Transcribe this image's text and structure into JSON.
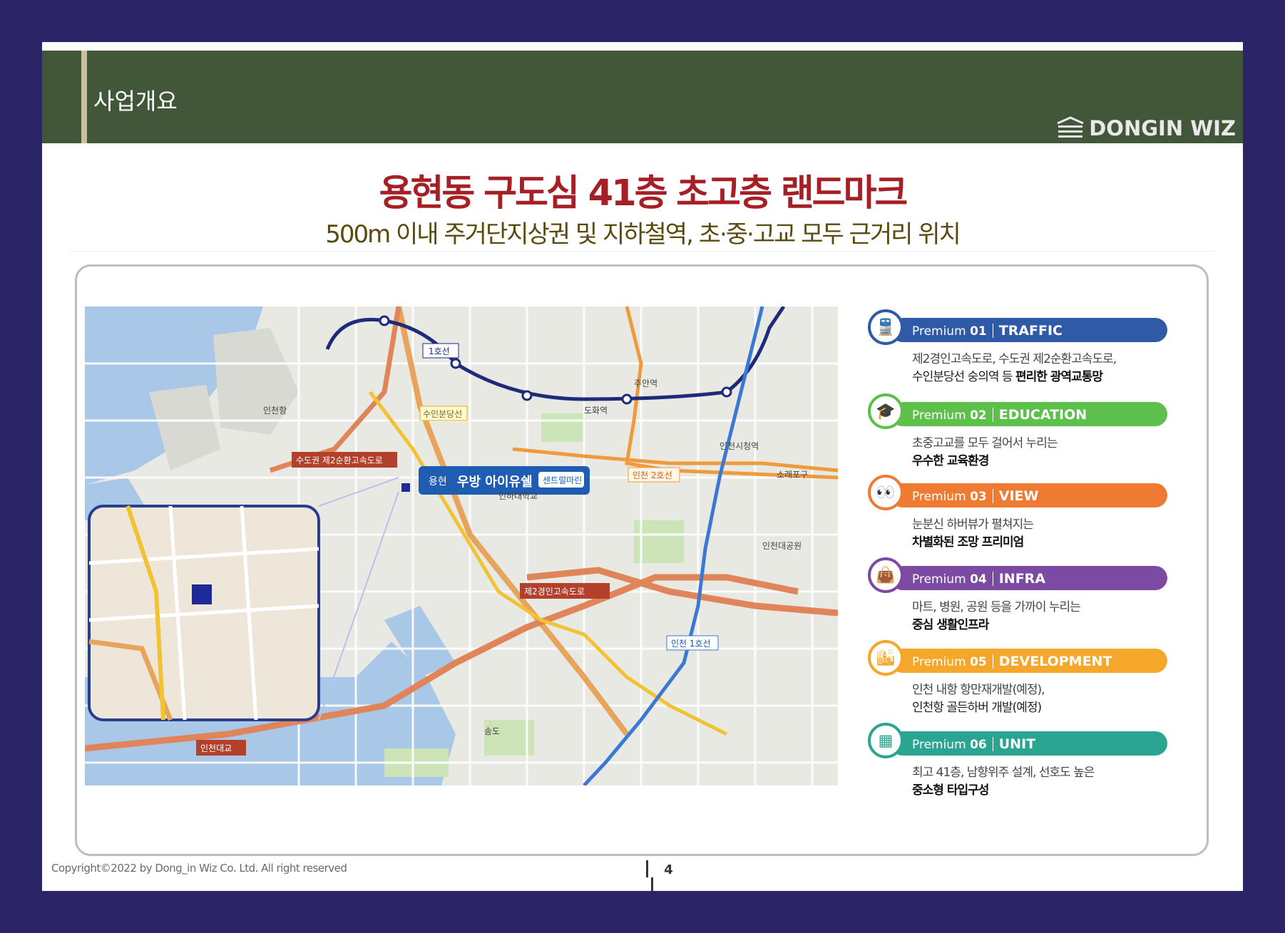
{
  "header": {
    "section_title": "사업개요",
    "logo_text": "DONGIN WIZ"
  },
  "headline": "용현동 구도심 41층 초고층 랜드마크",
  "subheadline": "500m 이내 주거단지상권 및 지하철역, 초·중·고교 모두 근거리 위치",
  "map": {
    "project_label_prefix": "용현",
    "project_label_main": "우방 아이유쉘",
    "project_label_tag": "센트럴마린",
    "road_labels": [
      "수도권 제2순환고속도로",
      "제2경인고속도로",
      "인천대교",
      "인천 2호선",
      "인천 1호선",
      "1호선",
      "수인분당선"
    ],
    "place_labels": [
      "인천항",
      "인하대학교",
      "송도",
      "도화역",
      "주안역",
      "인천시청역",
      "인천대공원",
      "소래포구"
    ]
  },
  "premiums": [
    {
      "label": "Premium",
      "num": "01",
      "category": "TRAFFIC",
      "color": "#2f5aa8",
      "icon": "train-icon",
      "glyph": "🚆",
      "line1": "제2경인고속도로, 수도권 제2순환고속도로,",
      "line2_normal": "수인분당선 숭의역 등 ",
      "line2_bold": "편리한 광역교통망"
    },
    {
      "label": "Premium",
      "num": "02",
      "category": "EDUCATION",
      "color": "#5cc04a",
      "icon": "graduation-cap-icon",
      "glyph": "🎓",
      "line1": "초중고교를 모두 걸어서 누리는",
      "line2_normal": "",
      "line2_bold": "우수한 교육환경"
    },
    {
      "label": "Premium",
      "num": "03",
      "category": "VIEW",
      "color": "#ef7b33",
      "icon": "binoculars-icon",
      "glyph": "👀",
      "line1": "눈분신 하버뷰가 펼쳐지는",
      "line2_normal": "",
      "line2_bold": "차별화된 조망 프리미엄"
    },
    {
      "label": "Premium",
      "num": "04",
      "category": "INFRA",
      "color": "#7d4aa3",
      "icon": "shopping-bag-icon",
      "glyph": "👜",
      "line1": "마트, 병원, 공원 등을 가까이 누리는",
      "line2_normal": "",
      "line2_bold": "중심 생활인프라"
    },
    {
      "label": "Premium",
      "num": "05",
      "category": "DEVELOPMENT",
      "color": "#f4a72a",
      "icon": "buildings-icon",
      "glyph": "🏙",
      "line1": "인천 내항 항만재개발(예정),",
      "line2_normal": "인천항 골든하버 개발(예정)",
      "line2_bold": ""
    },
    {
      "label": "Premium",
      "num": "06",
      "category": "UNIT",
      "color": "#2aa592",
      "icon": "floorplan-icon",
      "glyph": "▦",
      "line1": "최고 41층, 남향위주 설계, 선호도 높은",
      "line2_normal": "",
      "line2_bold": "중소형 타입구성"
    }
  ],
  "footer": {
    "copyright": "Copyright©2022 by Dong_in Wiz Co. Ltd. All right reserved",
    "page_number": "4"
  }
}
